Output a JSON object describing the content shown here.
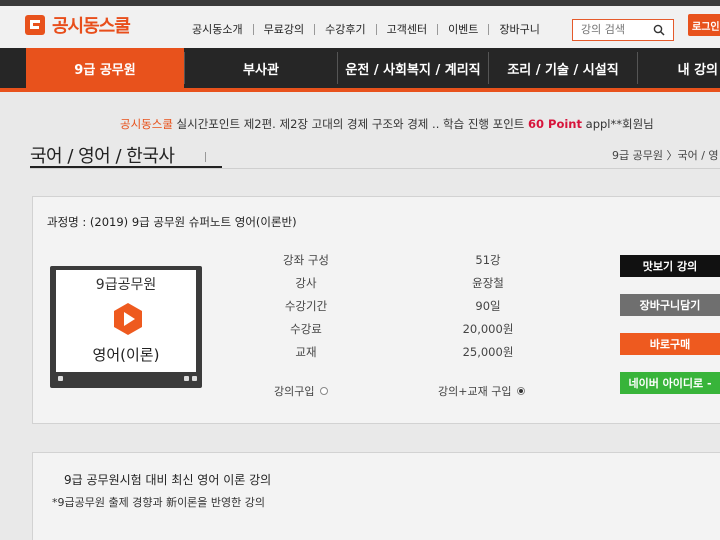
{
  "header": {
    "logo_text": "공시동스쿨",
    "nav": [
      "공시동소개",
      "무료강의",
      "수강후기",
      "고객센터",
      "이벤트",
      "장바구니"
    ],
    "search_placeholder": "강의 검색",
    "login_label": "로그인"
  },
  "categories": [
    "9급 공무원",
    "부사관",
    "운전 / 사회복지 / 계리직",
    "조리 / 기술 / 시설직",
    "내 강의"
  ],
  "ticker": {
    "brand": "공시동스쿨",
    "text": " 실시간포인트 제2편. 제2장 고대의 경제 구조와 경제 .. 학습 진행 포인트 ",
    "points": "60 Point",
    "user": " appl**회원님"
  },
  "page": {
    "title": "국어 / 영어 / 한국사",
    "breadcrumb": "9급 공무원 〉국어 / 영"
  },
  "course": {
    "name_label": "과정명 : (2019) 9급 공무원 슈퍼노트 영어(이론반)",
    "thumb_top": "9급공무원",
    "thumb_bottom": "영어(이론)",
    "info": [
      {
        "label": "강좌 구성",
        "value": "51강"
      },
      {
        "label": "강사",
        "value": "윤장철"
      },
      {
        "label": "수강기간",
        "value": "90일"
      },
      {
        "label": "수강료",
        "value": "20,000원"
      },
      {
        "label": "교재",
        "value": "25,000원"
      }
    ],
    "options": [
      {
        "label": "강의구입",
        "checked": false
      },
      {
        "label": "강의+교재 구입",
        "checked": true
      }
    ],
    "actions": [
      {
        "label": "맛보기 강의",
        "color": "#111111"
      },
      {
        "label": "장바구니담기",
        "color": "#6f6f6f"
      },
      {
        "label": "바로구매",
        "color": "#ee5a1f"
      },
      {
        "label": "네이버 아이디로 -",
        "color": "#38b43a"
      }
    ]
  },
  "description": {
    "title": "9급 공무원시험 대비 최신 영어 이론 강의",
    "text": "*9급공무원 출제 경향과 新이론을 반영한 강의"
  },
  "colors": {
    "accent": "#e8521c",
    "nav_bg": "#262626",
    "play": "#ee5a1f"
  }
}
